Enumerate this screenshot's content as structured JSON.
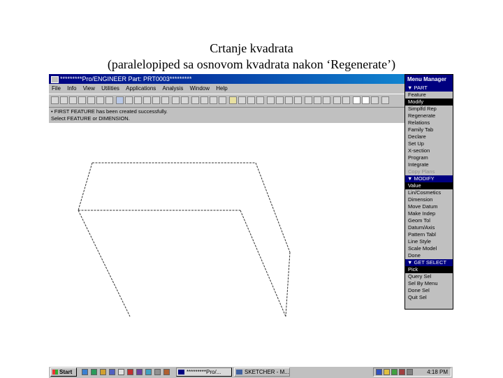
{
  "slide": {
    "title_line1": "Crtanje kvadrata",
    "title_line2": "(paralelopiped sa osnovom kvadrata nakon ‘Regenerate’)"
  },
  "window": {
    "title": "*********Pro/ENGINEER Part: PRT0003*********"
  },
  "menu": [
    "File",
    "Info",
    "View",
    "Utilities",
    "Applications",
    "Analysis",
    "Window",
    "Help"
  ],
  "messages": {
    "line1": "• FIRST FEATURE has been created successfully.",
    "line2": "Select FEATURE or DIMENSION."
  },
  "menu_manager": {
    "title": "Menu Manager",
    "part_header": "▼ PART",
    "part_items": [
      "Feature",
      "Modify",
      "Simplfd Rep",
      "Regenerate",
      "Relations",
      "Family Tab",
      "Declare",
      "Set Up",
      "X-section",
      "Program",
      "Integrate",
      "Copy Plans"
    ],
    "part_selected": "Modify",
    "part_disabled": "Copy Plans",
    "modify_header": "▼ MODIFY",
    "modify_items": [
      "Value",
      "Lin/Cosmetics",
      "Dimension",
      "Move Datum",
      "Make Indep",
      "Geom Tol",
      "Datum/Axis",
      "Pattern Tabl",
      "Line Style",
      "Scale Model",
      "Done"
    ],
    "modify_selected": "Value",
    "getselect_header": "▼ GET SELECT",
    "getselect_items": [
      "Pick",
      "Query Sel",
      "Sel By Menu",
      "Done Sel",
      "Quit Sel"
    ],
    "getselect_selected": "Pick"
  },
  "taskbar": {
    "start": "Start",
    "task1": "*********Pro/...",
    "task2": "SKETCHER - M...",
    "clock": "4:18 PM"
  }
}
